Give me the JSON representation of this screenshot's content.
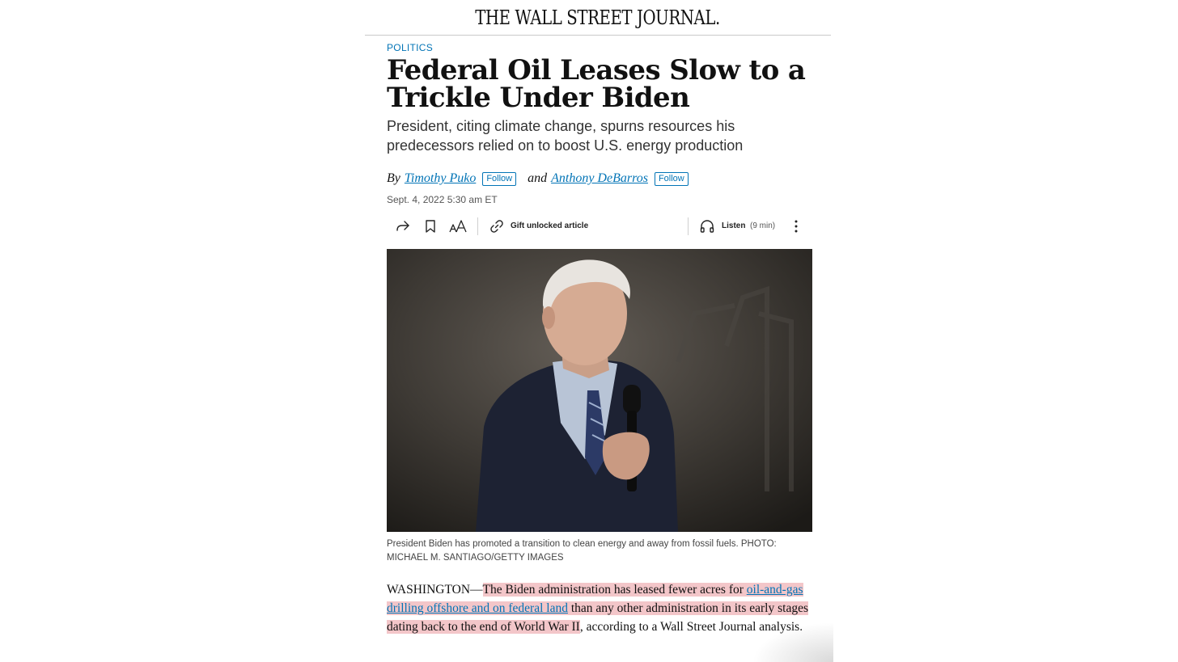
{
  "masthead": {
    "title": "THE WALL STREET JOURNAL."
  },
  "article": {
    "section": "POLITICS",
    "headline": "Federal Oil Leases Slow to a Trickle Under Biden",
    "dek": "President, citing climate change, spurns resources his predecessors relied on to boost U.S. energy production",
    "byline": {
      "prefix": "By",
      "author1": "Timothy Puko",
      "follow1": "Follow",
      "conjunction": "and",
      "author2": "Anthony DeBarros",
      "follow2": "Follow"
    },
    "timestamp": "Sept. 4, 2022 5:30 am ET",
    "toolbar": {
      "share_icon": "share-icon",
      "bookmark_icon": "bookmark-icon",
      "text_size_icon": "text-size-icon",
      "gift_icon": "link-icon",
      "gift_label": "Gift unlocked article",
      "listen_icon": "headphones-icon",
      "listen_label": "Listen",
      "listen_duration": "(9 min)",
      "more_icon": "more-vertical-icon"
    },
    "caption": "President Biden has promoted a transition to clean energy and away from fossil fuels. PHOTO: MICHAEL M. SANTIAGO/GETTY IMAGES",
    "body": {
      "dateline": "WASHINGTON—",
      "hl_part1": "The Biden administration has leased fewer acres for ",
      "link_text": "oil-and-gas drilling offshore and on federal land",
      "hl_part2": " than any other administration in its early stages dating back to the end of World War II",
      "tail": ", according to a Wall Street Journal analysis."
    }
  },
  "colors": {
    "link_blue": "#0274b6",
    "highlight_pink": "#f3c6c9",
    "text_dark": "#111111"
  }
}
